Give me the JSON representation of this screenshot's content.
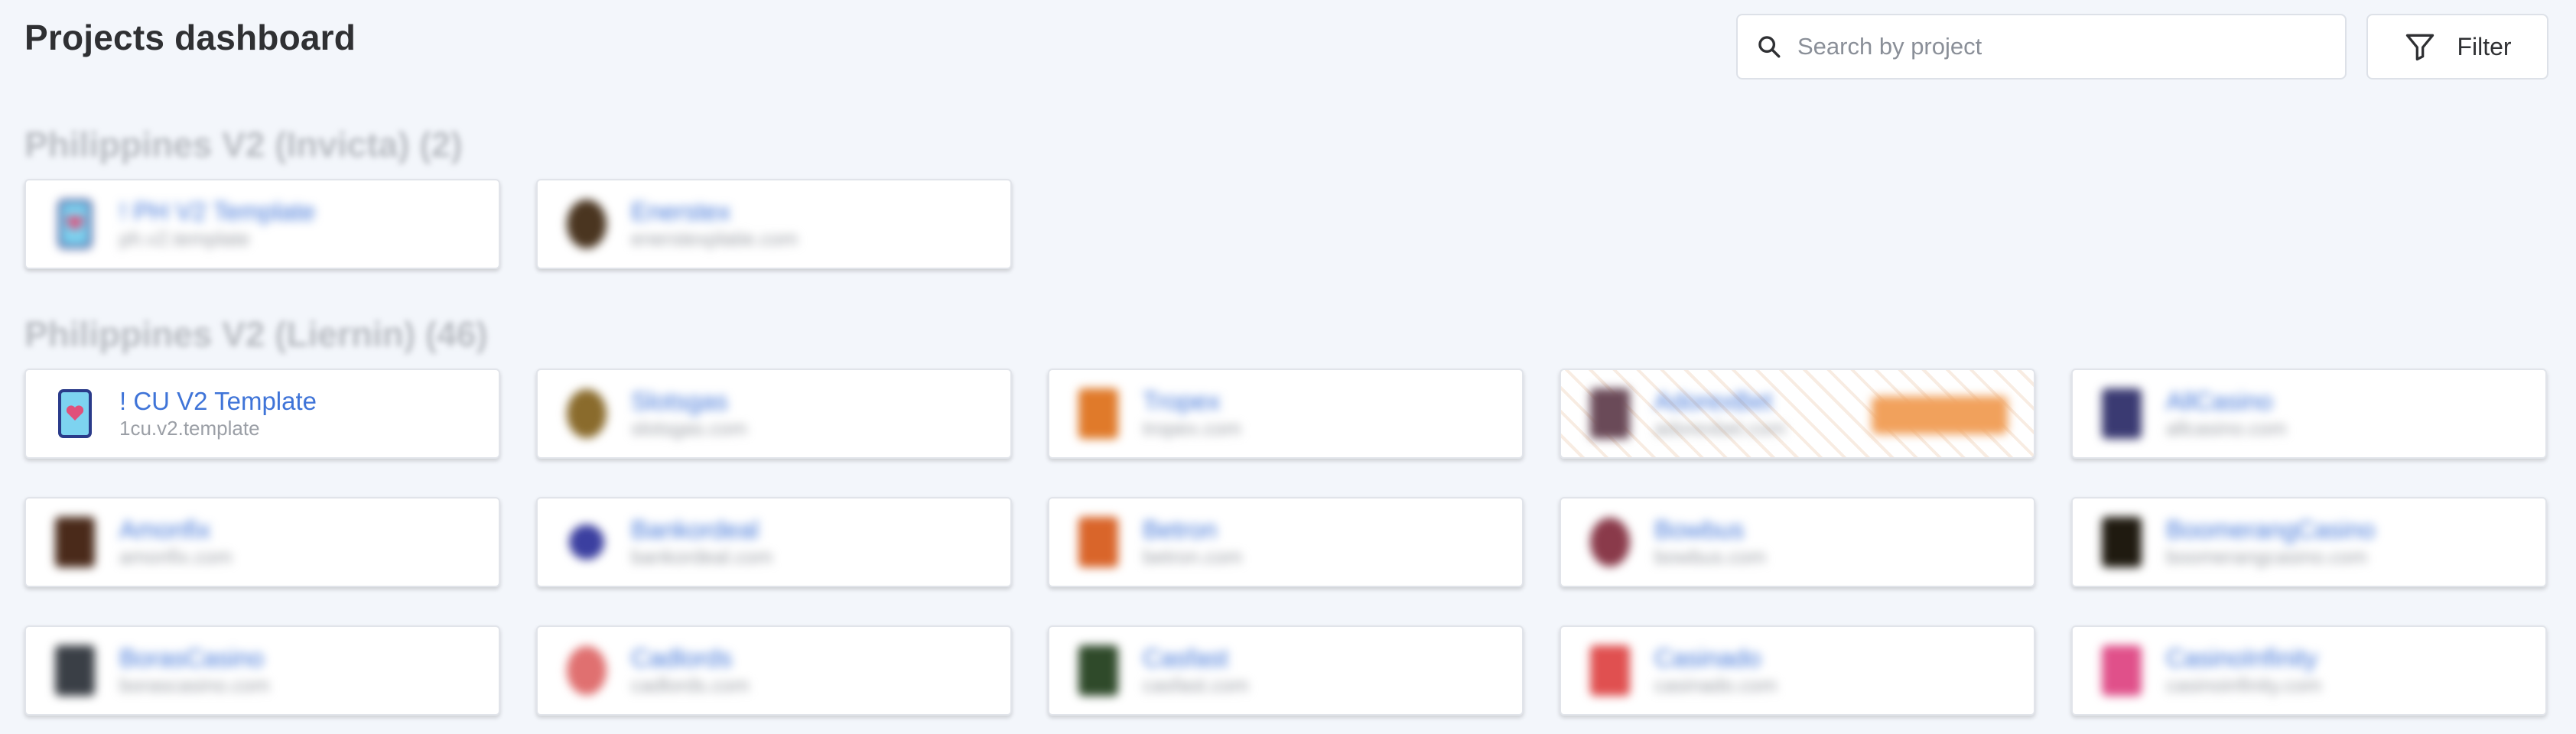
{
  "header": {
    "title": "Projects dashboard",
    "search_placeholder": "Search by project",
    "filter_label": "Filter"
  },
  "groups": [
    {
      "heading": "Philippines V2 (Invicta) (2)",
      "projects": [
        {
          "name": "! PH V2 Template",
          "slug": "ph.v2.template",
          "logo_color": "#7dd3f0",
          "logo_kind": "card"
        },
        {
          "name": "Enerstex",
          "slug": "enerstexplatie.com",
          "logo_color": "#4a3520",
          "logo_kind": "circle"
        }
      ]
    },
    {
      "heading": "Philippines V2 (Liernin) (46)",
      "projects": [
        {
          "name": "! CU V2 Template",
          "slug": "1cu.v2.template",
          "logo_color": "#7dd3f0",
          "logo_kind": "card"
        },
        {
          "name": "Slotsgas",
          "slug": "slotsgas.com",
          "logo_color": "#8a6b2c",
          "logo_kind": "circle"
        },
        {
          "name": "Tropex",
          "slug": "tropex.com",
          "logo_color": "#e07a2a",
          "logo_kind": "square"
        },
        {
          "name": "AdorexBet",
          "slug": "adorexbet.com",
          "logo_color": "#6a4a58",
          "logo_kind": "square"
        },
        {
          "name": "AllCasino",
          "slug": "allcasino.com",
          "logo_color": "#3a3a72",
          "logo_kind": "square"
        },
        {
          "name": "Amonfix",
          "slug": "amonfix.com",
          "logo_color": "#4a2a1a",
          "logo_kind": "square"
        },
        {
          "name": "Bankordeal",
          "slug": "bankordeal.com",
          "logo_color": "#3b3fa0",
          "logo_kind": "circle"
        },
        {
          "name": "Betron",
          "slug": "betron.com",
          "logo_color": "#d9652a",
          "logo_kind": "square"
        },
        {
          "name": "Bowbus",
          "slug": "bowbus.com",
          "logo_color": "#8a3a4a",
          "logo_kind": "circle"
        },
        {
          "name": "BoomerangCasino",
          "slug": "boomerangcasino.com",
          "logo_color": "#1f1a10",
          "logo_kind": "square"
        },
        {
          "name": "BorasCasino",
          "slug": "borascasino.com",
          "logo_color": "#3a3f46",
          "logo_kind": "square"
        },
        {
          "name": "Cadlords",
          "slug": "cadlords.com",
          "logo_color": "#e07070",
          "logo_kind": "circle"
        },
        {
          "name": "Casfast",
          "slug": "casfast.com",
          "logo_color": "#2f4a2a",
          "logo_kind": "square"
        },
        {
          "name": "Casinado",
          "slug": "casinado.com",
          "logo_color": "#e05050",
          "logo_kind": "square"
        },
        {
          "name": "CasinoInfinity",
          "slug": "casinoinfinity.com",
          "logo_color": "#e0508a",
          "logo_kind": "square"
        }
      ]
    }
  ]
}
